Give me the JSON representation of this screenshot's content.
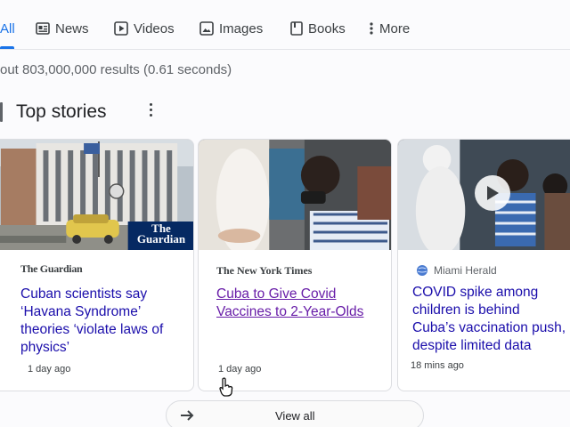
{
  "tabs": [
    {
      "label": "All",
      "icon": "none",
      "active": true
    },
    {
      "label": "News",
      "icon": "news-icon"
    },
    {
      "label": "Videos",
      "icon": "play-video-icon"
    },
    {
      "label": "Images",
      "icon": "image-icon"
    },
    {
      "label": "Books",
      "icon": "book-icon"
    },
    {
      "label": "More",
      "icon": "more-vertical-icon"
    }
  ],
  "results_stats": "out 803,000,000 results (0.61 seconds)",
  "section_title": "Top stories",
  "stories": [
    {
      "source": "The Guardian",
      "image_overlay_text": "The Guardian",
      "headline": "Cuban scientists say ‘Havana Syndrome’ theories ‘violate laws of physics’",
      "headline_lines": [
        "Cuban scientists say",
        "‘Havana Syndrome’",
        "theories ‘violate laws of",
        "physics’"
      ],
      "time": "1 day ago"
    },
    {
      "source": "The New York Times",
      "headline_lines": [
        "Cuba to Give Covid",
        "Vaccines to 2-Year-Olds"
      ],
      "time": "1 day ago",
      "visited": true
    },
    {
      "source": "Miami Herald",
      "headline_lines": [
        "COVID spike among",
        "children is behind",
        "Cuba’s vaccination push,",
        "despite limited data"
      ],
      "time": "18 mins ago",
      "has_video": true
    }
  ],
  "view_all": "View all",
  "colors": {
    "link": "#1a0dab",
    "visited_link": "#681da8",
    "active_tab": "#1a73e8",
    "guardian_blue": "#052962"
  }
}
